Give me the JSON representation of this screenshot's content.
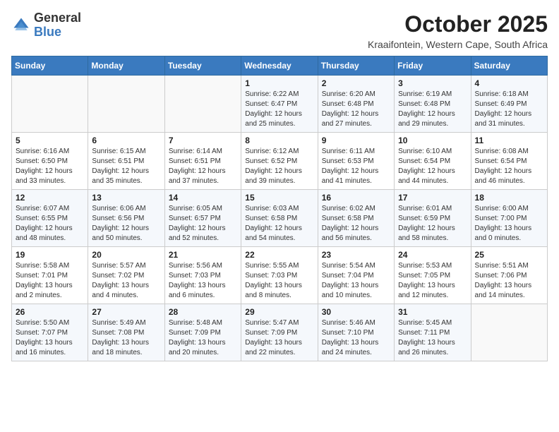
{
  "header": {
    "logo_general": "General",
    "logo_blue": "Blue",
    "month": "October 2025",
    "location": "Kraaifontein, Western Cape, South Africa"
  },
  "weekdays": [
    "Sunday",
    "Monday",
    "Tuesday",
    "Wednesday",
    "Thursday",
    "Friday",
    "Saturday"
  ],
  "weeks": [
    [
      {
        "day": "",
        "info": ""
      },
      {
        "day": "",
        "info": ""
      },
      {
        "day": "",
        "info": ""
      },
      {
        "day": "1",
        "info": "Sunrise: 6:22 AM\nSunset: 6:47 PM\nDaylight: 12 hours\nand 25 minutes."
      },
      {
        "day": "2",
        "info": "Sunrise: 6:20 AM\nSunset: 6:48 PM\nDaylight: 12 hours\nand 27 minutes."
      },
      {
        "day": "3",
        "info": "Sunrise: 6:19 AM\nSunset: 6:48 PM\nDaylight: 12 hours\nand 29 minutes."
      },
      {
        "day": "4",
        "info": "Sunrise: 6:18 AM\nSunset: 6:49 PM\nDaylight: 12 hours\nand 31 minutes."
      }
    ],
    [
      {
        "day": "5",
        "info": "Sunrise: 6:16 AM\nSunset: 6:50 PM\nDaylight: 12 hours\nand 33 minutes."
      },
      {
        "day": "6",
        "info": "Sunrise: 6:15 AM\nSunset: 6:51 PM\nDaylight: 12 hours\nand 35 minutes."
      },
      {
        "day": "7",
        "info": "Sunrise: 6:14 AM\nSunset: 6:51 PM\nDaylight: 12 hours\nand 37 minutes."
      },
      {
        "day": "8",
        "info": "Sunrise: 6:12 AM\nSunset: 6:52 PM\nDaylight: 12 hours\nand 39 minutes."
      },
      {
        "day": "9",
        "info": "Sunrise: 6:11 AM\nSunset: 6:53 PM\nDaylight: 12 hours\nand 41 minutes."
      },
      {
        "day": "10",
        "info": "Sunrise: 6:10 AM\nSunset: 6:54 PM\nDaylight: 12 hours\nand 44 minutes."
      },
      {
        "day": "11",
        "info": "Sunrise: 6:08 AM\nSunset: 6:54 PM\nDaylight: 12 hours\nand 46 minutes."
      }
    ],
    [
      {
        "day": "12",
        "info": "Sunrise: 6:07 AM\nSunset: 6:55 PM\nDaylight: 12 hours\nand 48 minutes."
      },
      {
        "day": "13",
        "info": "Sunrise: 6:06 AM\nSunset: 6:56 PM\nDaylight: 12 hours\nand 50 minutes."
      },
      {
        "day": "14",
        "info": "Sunrise: 6:05 AM\nSunset: 6:57 PM\nDaylight: 12 hours\nand 52 minutes."
      },
      {
        "day": "15",
        "info": "Sunrise: 6:03 AM\nSunset: 6:58 PM\nDaylight: 12 hours\nand 54 minutes."
      },
      {
        "day": "16",
        "info": "Sunrise: 6:02 AM\nSunset: 6:58 PM\nDaylight: 12 hours\nand 56 minutes."
      },
      {
        "day": "17",
        "info": "Sunrise: 6:01 AM\nSunset: 6:59 PM\nDaylight: 12 hours\nand 58 minutes."
      },
      {
        "day": "18",
        "info": "Sunrise: 6:00 AM\nSunset: 7:00 PM\nDaylight: 13 hours\nand 0 minutes."
      }
    ],
    [
      {
        "day": "19",
        "info": "Sunrise: 5:58 AM\nSunset: 7:01 PM\nDaylight: 13 hours\nand 2 minutes."
      },
      {
        "day": "20",
        "info": "Sunrise: 5:57 AM\nSunset: 7:02 PM\nDaylight: 13 hours\nand 4 minutes."
      },
      {
        "day": "21",
        "info": "Sunrise: 5:56 AM\nSunset: 7:03 PM\nDaylight: 13 hours\nand 6 minutes."
      },
      {
        "day": "22",
        "info": "Sunrise: 5:55 AM\nSunset: 7:03 PM\nDaylight: 13 hours\nand 8 minutes."
      },
      {
        "day": "23",
        "info": "Sunrise: 5:54 AM\nSunset: 7:04 PM\nDaylight: 13 hours\nand 10 minutes."
      },
      {
        "day": "24",
        "info": "Sunrise: 5:53 AM\nSunset: 7:05 PM\nDaylight: 13 hours\nand 12 minutes."
      },
      {
        "day": "25",
        "info": "Sunrise: 5:51 AM\nSunset: 7:06 PM\nDaylight: 13 hours\nand 14 minutes."
      }
    ],
    [
      {
        "day": "26",
        "info": "Sunrise: 5:50 AM\nSunset: 7:07 PM\nDaylight: 13 hours\nand 16 minutes."
      },
      {
        "day": "27",
        "info": "Sunrise: 5:49 AM\nSunset: 7:08 PM\nDaylight: 13 hours\nand 18 minutes."
      },
      {
        "day": "28",
        "info": "Sunrise: 5:48 AM\nSunset: 7:09 PM\nDaylight: 13 hours\nand 20 minutes."
      },
      {
        "day": "29",
        "info": "Sunrise: 5:47 AM\nSunset: 7:09 PM\nDaylight: 13 hours\nand 22 minutes."
      },
      {
        "day": "30",
        "info": "Sunrise: 5:46 AM\nSunset: 7:10 PM\nDaylight: 13 hours\nand 24 minutes."
      },
      {
        "day": "31",
        "info": "Sunrise: 5:45 AM\nSunset: 7:11 PM\nDaylight: 13 hours\nand 26 minutes."
      },
      {
        "day": "",
        "info": ""
      }
    ]
  ]
}
